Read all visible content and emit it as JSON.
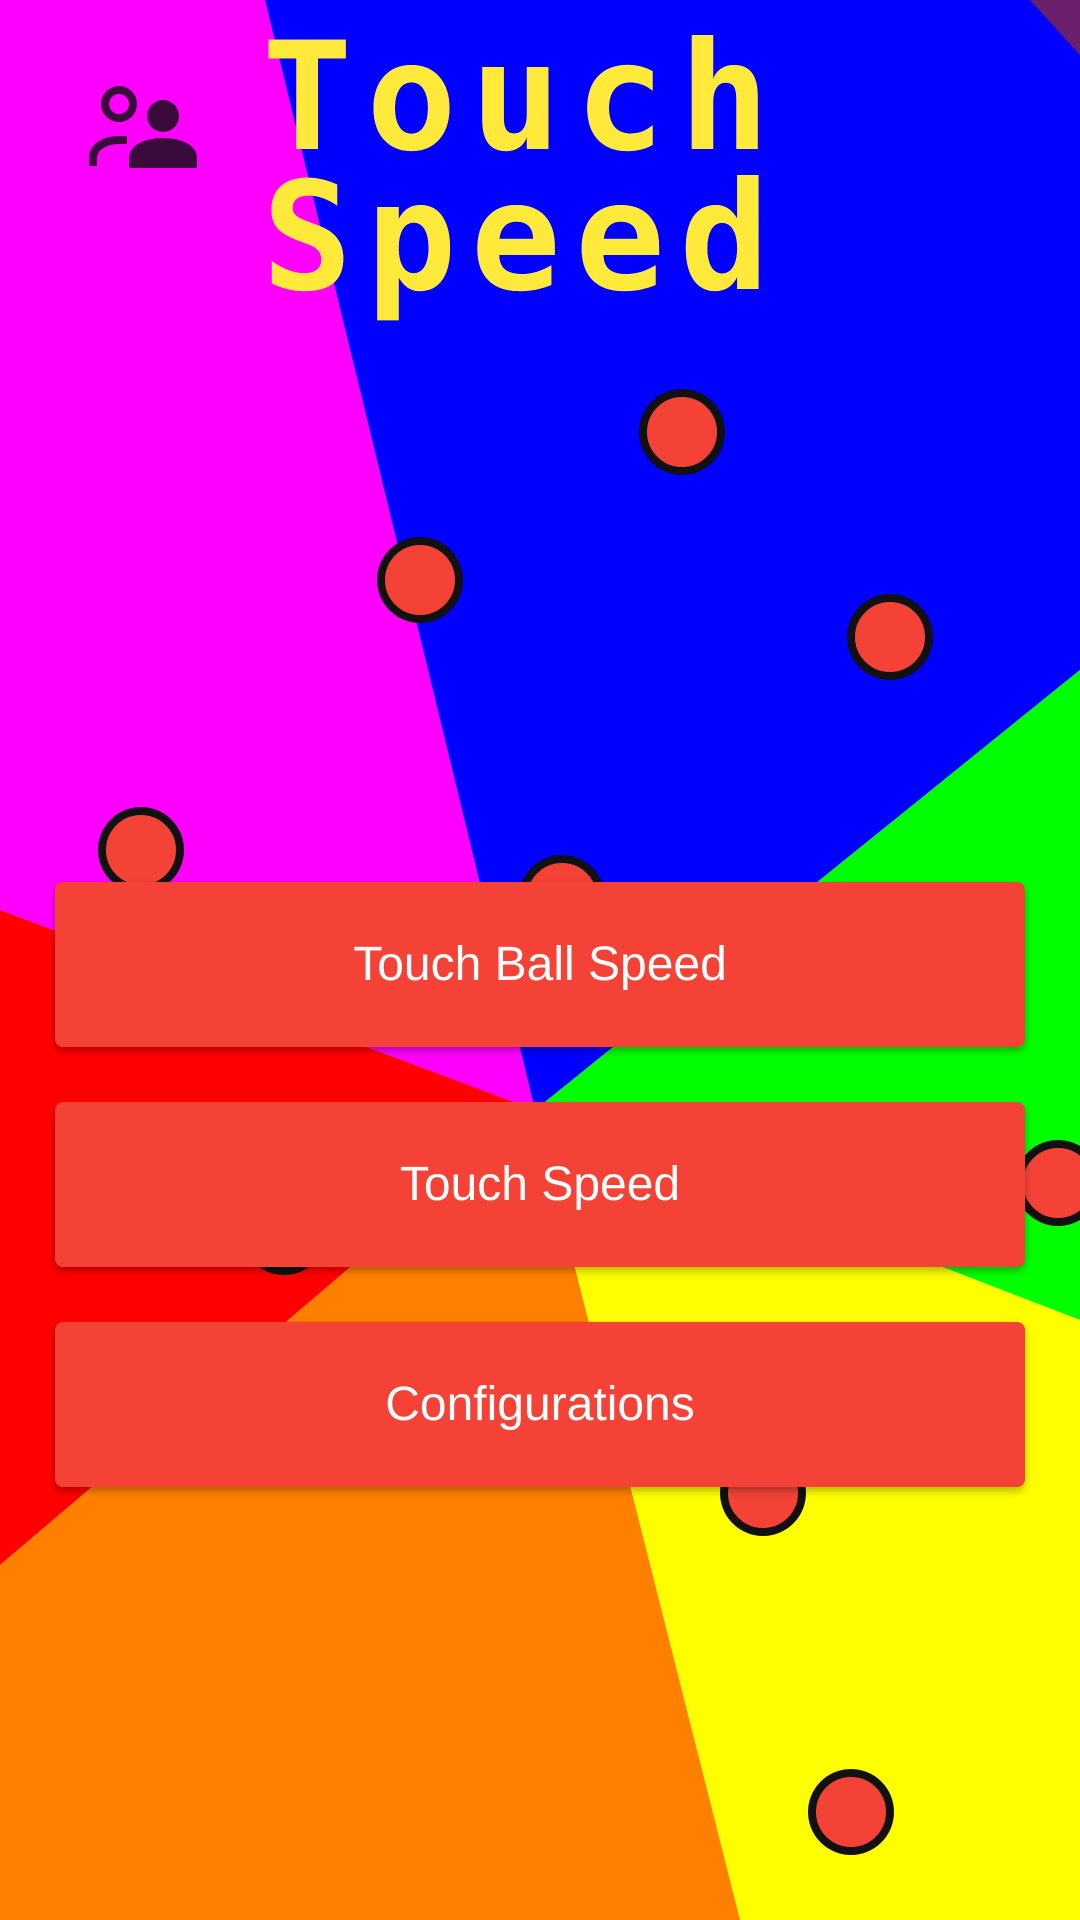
{
  "app": {
    "title": "Touch\nSpeed"
  },
  "header": {
    "players_icon": "people-group-icon"
  },
  "menu": {
    "items": [
      {
        "label": "Touch Ball Speed"
      },
      {
        "label": "Touch Speed"
      },
      {
        "label": "Configurations"
      }
    ]
  },
  "colors": {
    "title": "#FFE93B",
    "button_bg": "#F44336",
    "button_text": "#FFFFFF",
    "ball_fill": "#F44336",
    "ball_stroke": "#111111",
    "icon": "#3A0A3A",
    "sectors": {
      "magenta": "#FF00FF",
      "blue": "#0000FF",
      "green": "#00FF00",
      "yellow": "#FFFF00",
      "orange": "#FF7F00",
      "red": "#FF0000"
    }
  },
  "background": {
    "balls_count": 11
  }
}
